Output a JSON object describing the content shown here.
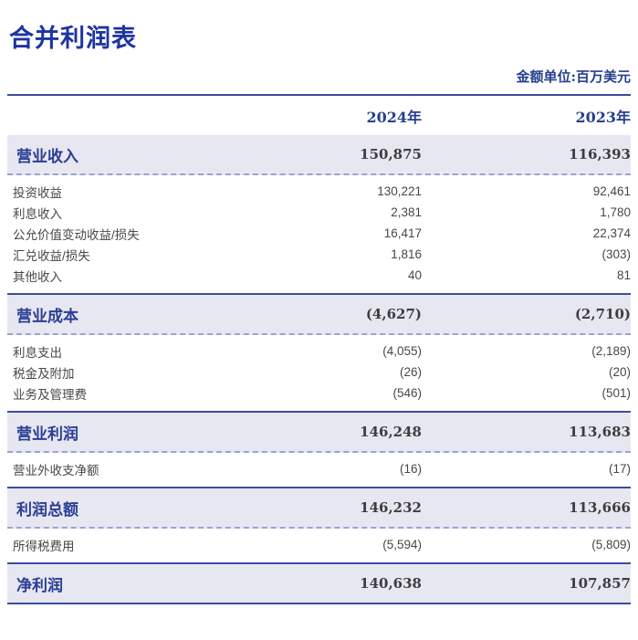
{
  "page": {
    "title": "合并利润表",
    "unit_note": "金额单位:百万美元"
  },
  "colors": {
    "title_blue": "#1e34a0",
    "serif_navy": "#27408e",
    "section_label_blue": "#2a3e93",
    "row_background": "#e7e7f2",
    "solid_line": "#3c4ba0",
    "dashed_line": "#9aa4ce",
    "number_dark": "#3d3d3d",
    "detail_text": "#474747"
  },
  "table": {
    "columns": {
      "y2024": "2024年",
      "y2023": "2023年"
    },
    "sections": [
      {
        "header": {
          "label": "营业收入",
          "v2024": "150,875",
          "v2023": "116,393"
        },
        "rows": [
          {
            "label": "投资收益",
            "v2024": "130,221",
            "v2023": "92,461"
          },
          {
            "label": "利息收入",
            "v2024": "2,381",
            "v2023": "1,780"
          },
          {
            "label": "公允价值变动收益/损失",
            "v2024": "16,417",
            "v2023": "22,374"
          },
          {
            "label": "汇兑收益/损失",
            "v2024": "1,816",
            "v2023": "(303)"
          },
          {
            "label": "其他收入",
            "v2024": "40",
            "v2023": "81"
          }
        ]
      },
      {
        "header": {
          "label": "营业成本",
          "v2024": "(4,627)",
          "v2023": "(2,710)"
        },
        "rows": [
          {
            "label": "利息支出",
            "v2024": "(4,055)",
            "v2023": "(2,189)"
          },
          {
            "label": "税金及附加",
            "v2024": "(26)",
            "v2023": "(20)"
          },
          {
            "label": "业务及管理费",
            "v2024": "(546)",
            "v2023": "(501)"
          }
        ]
      },
      {
        "header": {
          "label": "营业利润",
          "v2024": "146,248",
          "v2023": "113,683"
        },
        "rows": [
          {
            "label": "营业外收支净额",
            "v2024": "(16)",
            "v2023": "(17)"
          }
        ]
      },
      {
        "header": {
          "label": "利润总额",
          "v2024": "146,232",
          "v2023": "113,666"
        },
        "rows": [
          {
            "label": "所得税费用",
            "v2024": "(5,594)",
            "v2023": "(5,809)"
          }
        ]
      },
      {
        "header": {
          "label": "净利润",
          "v2024": "140,638",
          "v2023": "107,857"
        },
        "rows": []
      }
    ]
  }
}
